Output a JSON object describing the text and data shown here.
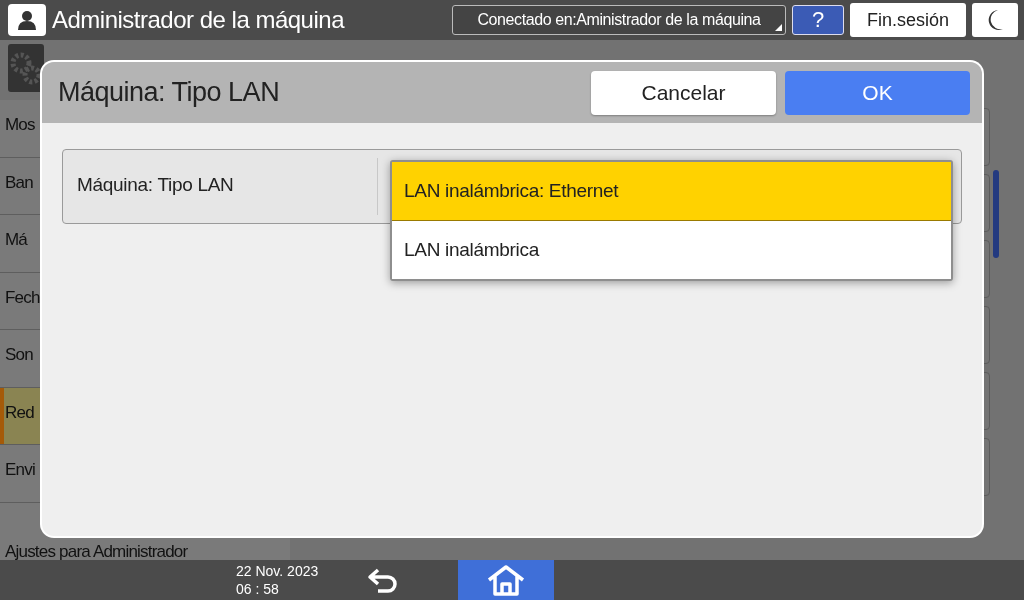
{
  "header": {
    "title": "Administrador de la máquina",
    "login_status": "Conectado en:Aministrador de la máquina",
    "help_button": "?",
    "logout_button": "Fin.sesión"
  },
  "sidebar": {
    "items": [
      {
        "label": "Mos",
        "selected": false
      },
      {
        "label": "Ban",
        "selected": false
      },
      {
        "label": "Má",
        "selected": false
      },
      {
        "label": "Fech",
        "selected": false
      },
      {
        "label": "Son",
        "selected": false
      },
      {
        "label": "Red",
        "selected": true
      },
      {
        "label": "Envi",
        "selected": false
      },
      {
        "label": "Ajustes para Administrador",
        "selected": false
      }
    ]
  },
  "dialog": {
    "title": "Máquina: Tipo LAN",
    "cancel_button": "Cancelar",
    "ok_button": "OK",
    "setting": {
      "label": "Máquina: Tipo LAN",
      "options": [
        {
          "label": "LAN inalámbrica: Ethernet",
          "selected": true
        },
        {
          "label": "LAN inalámbrica",
          "selected": false
        }
      ]
    }
  },
  "footer": {
    "date": "22 Nov. 2023",
    "time": "06 : 58"
  }
}
